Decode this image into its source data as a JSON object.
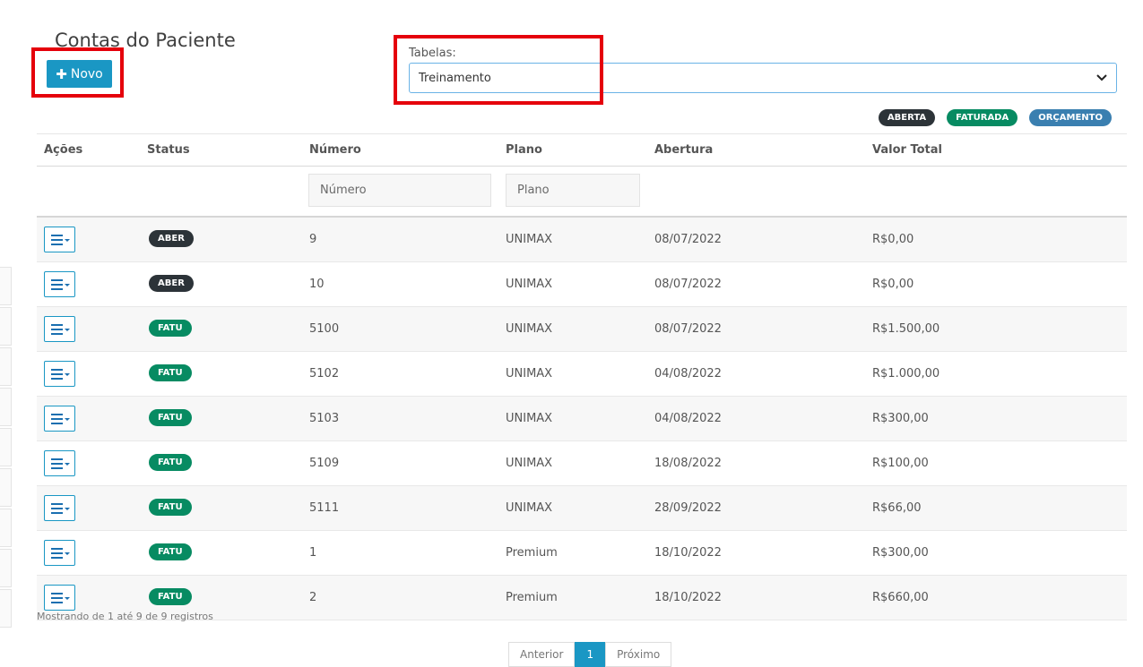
{
  "page": {
    "title": "Contas do Paciente"
  },
  "toolbar": {
    "new_label": "Novo",
    "new_icon": "plus-icon"
  },
  "tabelas": {
    "label": "Tabelas:",
    "selected": "Treinamento"
  },
  "legend": [
    {
      "label": "ABERTA",
      "color": "#2c3338"
    },
    {
      "label": "FATURADA",
      "color": "#078b62"
    },
    {
      "label": "ORÇAMENTO",
      "color": "#3a7fb0"
    }
  ],
  "table": {
    "headers": {
      "acoes": "Ações",
      "status": "Status",
      "numero": "Número",
      "plano": "Plano",
      "abertura": "Abertura",
      "valor": "Valor Total"
    },
    "filters": {
      "numero_placeholder": "Número",
      "plano_placeholder": "Plano"
    },
    "rows": [
      {
        "status": "ABER",
        "numero": "9",
        "plano": "UNIMAX",
        "abertura": "08/07/2022",
        "valor": "R$0,00"
      },
      {
        "status": "ABER",
        "numero": "10",
        "plano": "UNIMAX",
        "abertura": "08/07/2022",
        "valor": "R$0,00"
      },
      {
        "status": "FATU",
        "numero": "5100",
        "plano": "UNIMAX",
        "abertura": "08/07/2022",
        "valor": "R$1.500,00"
      },
      {
        "status": "FATU",
        "numero": "5102",
        "plano": "UNIMAX",
        "abertura": "04/08/2022",
        "valor": "R$1.000,00"
      },
      {
        "status": "FATU",
        "numero": "5103",
        "plano": "UNIMAX",
        "abertura": "04/08/2022",
        "valor": "R$300,00"
      },
      {
        "status": "FATU",
        "numero": "5109",
        "plano": "UNIMAX",
        "abertura": "18/08/2022",
        "valor": "R$100,00"
      },
      {
        "status": "FATU",
        "numero": "5111",
        "plano": "UNIMAX",
        "abertura": "28/09/2022",
        "valor": "R$66,00"
      },
      {
        "status": "FATU",
        "numero": "1",
        "plano": "Premium",
        "abertura": "18/10/2022",
        "valor": "R$300,00"
      },
      {
        "status": "FATU",
        "numero": "2",
        "plano": "Premium",
        "abertura": "18/10/2022",
        "valor": "R$660,00"
      }
    ],
    "info": "Mostrando de 1 até 9 de 9 registros"
  },
  "pagination": {
    "prev": "Anterior",
    "current": "1",
    "next": "Próximo"
  }
}
